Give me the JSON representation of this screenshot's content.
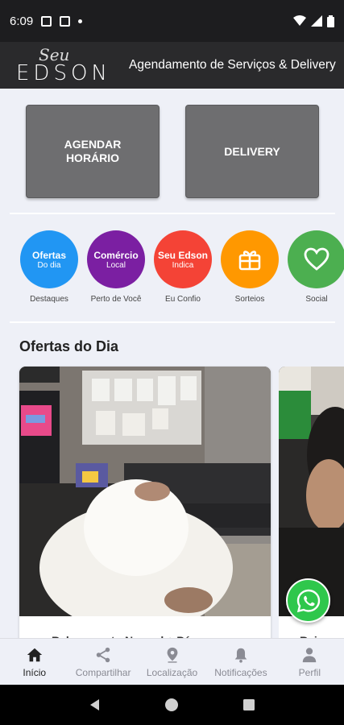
{
  "status_bar": {
    "time": "6:09"
  },
  "header": {
    "logo_top": "Seu",
    "logo_main": "EDSON",
    "subtitle": "Agendamento de Serviços & Delivery"
  },
  "main_buttons": {
    "agendar": "AGENDAR HORÁRIO",
    "delivery": "DELIVERY"
  },
  "categories": [
    {
      "title": "Ofertas",
      "sub": "Do dia",
      "label": "Destaques",
      "color": "#2196f3"
    },
    {
      "title": "Comércio",
      "sub": "Local",
      "label": "Perto de Você",
      "color": "#7b1fa2"
    },
    {
      "title": "Seu Edson",
      "sub": "Indica",
      "label": "Eu Confio",
      "color": "#f44336"
    },
    {
      "title": "",
      "sub": "",
      "label": "Sorteios",
      "color": "#ff9800",
      "icon": "gift-icon"
    },
    {
      "title": "",
      "sub": "",
      "label": "Social",
      "color": "#4caf50",
      "icon": "heart-icon"
    }
  ],
  "offers": {
    "title": "Ofertas do Dia",
    "items": [
      {
        "caption": "Relaxamento Normal + Pé"
      },
      {
        "caption": "Rei"
      }
    ]
  },
  "bottom_nav": [
    {
      "label": "Início",
      "icon": "home-icon",
      "active": true
    },
    {
      "label": "Compartilhar",
      "icon": "share-icon"
    },
    {
      "label": "Localização",
      "icon": "location-icon"
    },
    {
      "label": "Notificações",
      "icon": "bell-icon"
    },
    {
      "label": "Perfil",
      "icon": "person-icon"
    }
  ]
}
